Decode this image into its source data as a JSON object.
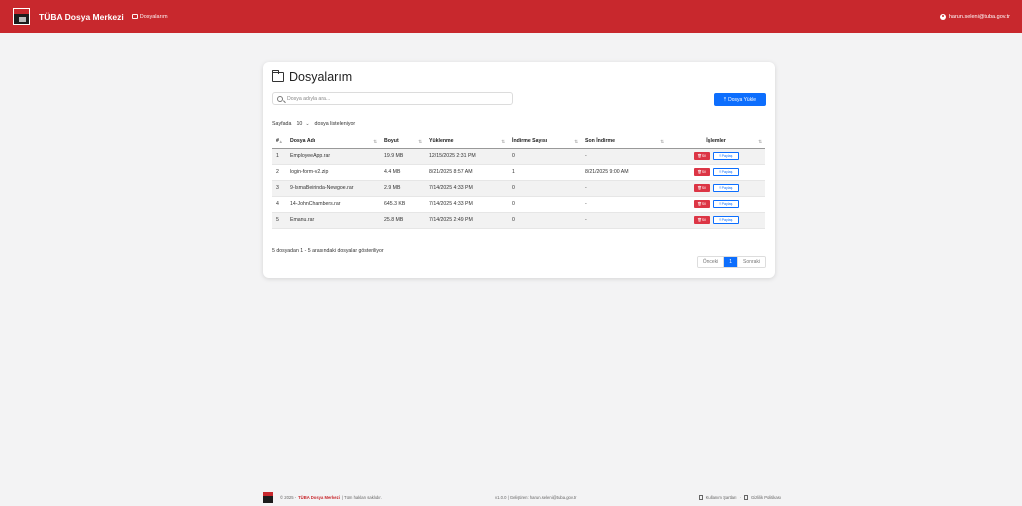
{
  "header": {
    "brand": "TÜBA Dosya Merkezi",
    "nav_link": "Dosyalarım",
    "user_email": "harun.seleni@tuba.gov.tr"
  },
  "main": {
    "title": "Dosyalarım",
    "search_placeholder": "Dosya adıyla ara...",
    "upload_label": "Dosya Yükle",
    "page_size_prefix": "Sayfada",
    "page_size_value": "10",
    "page_size_suffix": "dosya listeleniyor",
    "columns": [
      "#",
      "Dosya Adı",
      "Boyut",
      "Yüklenme",
      "İndirme Sayısı",
      "Son İndirme",
      "İşlemler"
    ],
    "rows": [
      {
        "id": "1",
        "name": "EmployeeApp.rar",
        "size": "19.9 MB",
        "uploaded": "12/15/2025 2:31 PM",
        "downloads": "0",
        "last": "-"
      },
      {
        "id": "2",
        "name": "login-form-v2.zip",
        "size": "4.4 MB",
        "uploaded": "8/21/2025 8:57 AM",
        "downloads": "1",
        "last": "8/21/2025 9:00 AM"
      },
      {
        "id": "3",
        "name": "9-IsmaBeirinda-Newgoe.rar",
        "size": "2.9 MB",
        "uploaded": "7/14/2025 4:33 PM",
        "downloads": "0",
        "last": "-"
      },
      {
        "id": "4",
        "name": "14-JohnChambers.rar",
        "size": "645.3 KB",
        "uploaded": "7/14/2025 4:33 PM",
        "downloads": "0",
        "last": "-"
      },
      {
        "id": "5",
        "name": "Emanu.rar",
        "size": "25.8 MB",
        "uploaded": "7/14/2025 2:49 PM",
        "downloads": "0",
        "last": "-"
      }
    ],
    "delete_label": "Sil",
    "share_label": "Paylaş",
    "table_info": "5 dosyadan 1 - 5 arasındaki dosyalar gösteriliyor",
    "pagination": {
      "prev": "Önceki",
      "current": "1",
      "next": "Sonraki"
    }
  },
  "footer": {
    "copyright": "© 2025 -",
    "brand": "TÜBA Dosya Merkezi",
    "rights": "| Tüm hakları saklıdır.",
    "version": "v1.0.0 | Geliştiren: harun.seleni@tuba.gov.tr",
    "terms": "Kullanım Şartları",
    "privacy": "Gizlilik Politikası"
  },
  "colors": {
    "navbar": "#c8282d",
    "primary": "#0d6efd",
    "danger": "#dc3545"
  }
}
